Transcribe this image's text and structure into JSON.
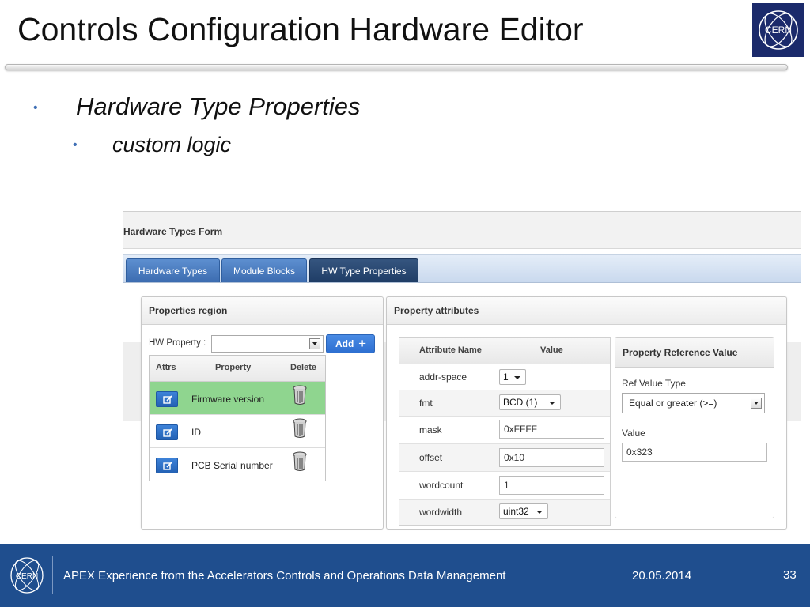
{
  "slide": {
    "title": "Controls Configuration Hardware Editor",
    "logo_text": "CERN",
    "bullets": [
      "Hardware Type Properties",
      "custom logic"
    ]
  },
  "app": {
    "form_title": "Hardware Types Form",
    "tabs": [
      {
        "label": "Hardware Types",
        "active": false
      },
      {
        "label": "Module Blocks",
        "active": false
      },
      {
        "label": "HW Type Properties",
        "active": true
      }
    ],
    "properties_region": {
      "title": "Properties region",
      "hw_property_label": "HW Property :",
      "hw_property_value": "",
      "add_label": "Add",
      "table": {
        "headers": [
          "Attrs",
          "Property",
          "Delete"
        ],
        "rows": [
          {
            "property": "Firmware version",
            "selected": true
          },
          {
            "property": "ID",
            "selected": false
          },
          {
            "property": "PCB Serial number",
            "selected": false
          }
        ]
      }
    },
    "property_attributes": {
      "title": "Property attributes",
      "headers": [
        "Attribute Name",
        "Value"
      ],
      "rows": [
        {
          "name": "addr-space",
          "value": "1",
          "kind": "select"
        },
        {
          "name": "fmt",
          "value": "BCD (1)",
          "kind": "select"
        },
        {
          "name": "mask",
          "value": "0xFFFF",
          "kind": "input"
        },
        {
          "name": "offset",
          "value": "0x10",
          "kind": "input"
        },
        {
          "name": "wordcount",
          "value": "1",
          "kind": "input"
        },
        {
          "name": "wordwidth",
          "value": "uint32",
          "kind": "select"
        }
      ],
      "reference": {
        "title": "Property Reference Value",
        "ref_type_label": "Ref Value Type",
        "ref_type_value": "Equal or greater (>=)",
        "value_label": "Value",
        "value": "0x323"
      }
    }
  },
  "footer": {
    "logo_text": "CERN",
    "text": "APEX Experience from the Accelerators Controls and Operations Data Management",
    "date": "20.05.2014",
    "page": "33"
  },
  "colors": {
    "footer_bg": "#1f4e8e",
    "tab_blue": "#3c6cb0",
    "tab_active": "#1f3d66",
    "selected_row": "#8fd58f",
    "add_button": "#2d6fd1"
  }
}
